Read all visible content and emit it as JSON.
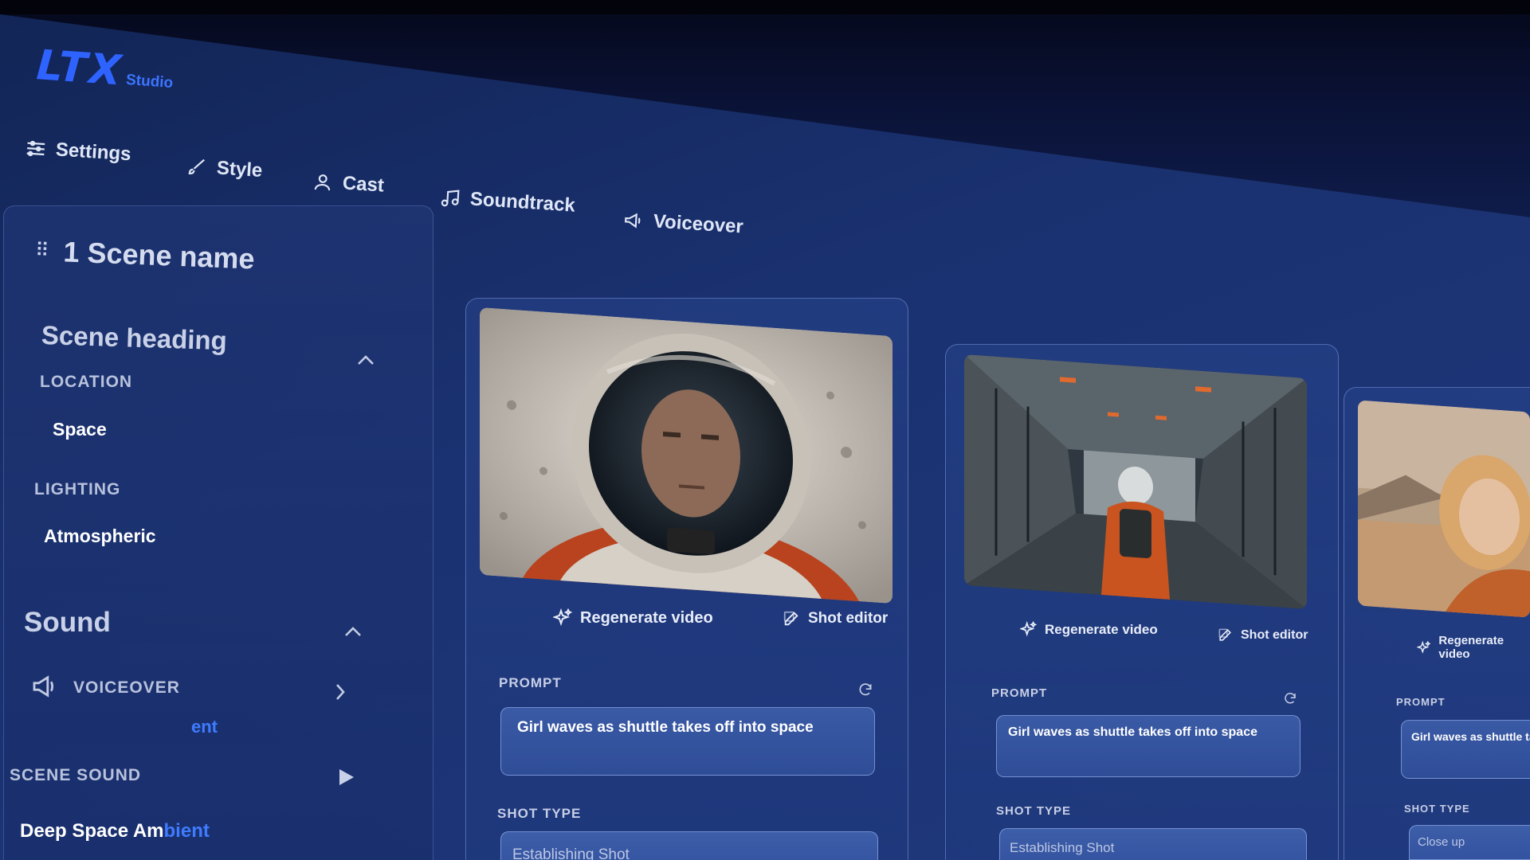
{
  "brand": {
    "logo_main": "LTX",
    "logo_sub": "Studio"
  },
  "tabs": [
    {
      "label": "Settings",
      "icon": "sliders-icon"
    },
    {
      "label": "Style",
      "icon": "brush-icon"
    },
    {
      "label": "Cast",
      "icon": "person-icon"
    },
    {
      "label": "Soundtrack",
      "icon": "music-note-icon"
    },
    {
      "label": "Voiceover",
      "icon": "megaphone-icon"
    }
  ],
  "sidebar": {
    "scene_title": "1 Scene name",
    "scene_heading": {
      "title": "Scene heading",
      "location_label": "LOCATION",
      "location_value": "Space",
      "lighting_label": "LIGHTING",
      "lighting_value": "Atmospheric"
    },
    "sound": {
      "title": "Sound",
      "voiceover_label": "VOICEOVER",
      "partial_text": "ent",
      "scene_sound_label": "SCENE SOUND",
      "scene_sound_value_a": "Deep Space Am",
      "scene_sound_value_b": "bient"
    }
  },
  "shots": [
    {
      "regenerate_label": "Regenerate video",
      "shot_editor_label": "Shot editor",
      "prompt_label": "PROMPT",
      "prompt_value": "Girl waves as shuttle takes off into space",
      "shot_type_label": "SHOT TYPE",
      "shot_type_value": "Establishing Shot"
    },
    {
      "regenerate_label": "Regenerate video",
      "shot_editor_label": "Shot editor",
      "prompt_label": "PROMPT",
      "prompt_value": "Girl waves as shuttle takes off into space",
      "shot_type_label": "SHOT TYPE",
      "shot_type_value": "Establishing Shot"
    },
    {
      "regenerate_label": "Regenerate video",
      "prompt_label": "PROMPT",
      "prompt_value": "Girl waves as shuttle ta",
      "shot_type_label": "SHOT TYPE",
      "shot_type_value": "Close up"
    }
  ],
  "colors": {
    "accent": "#2f63ff",
    "panel": "#1a3170",
    "input": "#3a5aa6"
  }
}
